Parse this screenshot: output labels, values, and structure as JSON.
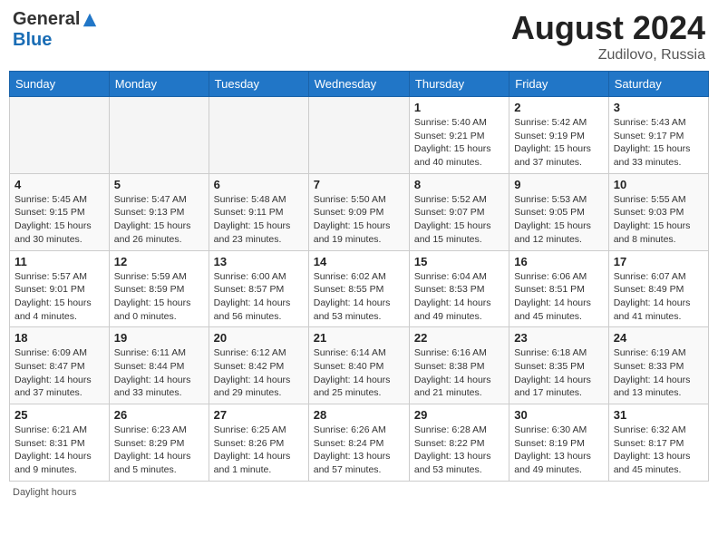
{
  "logo": {
    "general": "General",
    "blue": "Blue"
  },
  "title": {
    "month_year": "August 2024",
    "location": "Zudilovo, Russia"
  },
  "days_of_week": [
    "Sunday",
    "Monday",
    "Tuesday",
    "Wednesday",
    "Thursday",
    "Friday",
    "Saturday"
  ],
  "footer": {
    "daylight_label": "Daylight hours"
  },
  "weeks": [
    [
      {
        "day": "",
        "info": ""
      },
      {
        "day": "",
        "info": ""
      },
      {
        "day": "",
        "info": ""
      },
      {
        "day": "",
        "info": ""
      },
      {
        "day": "1",
        "info": "Sunrise: 5:40 AM\nSunset: 9:21 PM\nDaylight: 15 hours\nand 40 minutes."
      },
      {
        "day": "2",
        "info": "Sunrise: 5:42 AM\nSunset: 9:19 PM\nDaylight: 15 hours\nand 37 minutes."
      },
      {
        "day": "3",
        "info": "Sunrise: 5:43 AM\nSunset: 9:17 PM\nDaylight: 15 hours\nand 33 minutes."
      }
    ],
    [
      {
        "day": "4",
        "info": "Sunrise: 5:45 AM\nSunset: 9:15 PM\nDaylight: 15 hours\nand 30 minutes."
      },
      {
        "day": "5",
        "info": "Sunrise: 5:47 AM\nSunset: 9:13 PM\nDaylight: 15 hours\nand 26 minutes."
      },
      {
        "day": "6",
        "info": "Sunrise: 5:48 AM\nSunset: 9:11 PM\nDaylight: 15 hours\nand 23 minutes."
      },
      {
        "day": "7",
        "info": "Sunrise: 5:50 AM\nSunset: 9:09 PM\nDaylight: 15 hours\nand 19 minutes."
      },
      {
        "day": "8",
        "info": "Sunrise: 5:52 AM\nSunset: 9:07 PM\nDaylight: 15 hours\nand 15 minutes."
      },
      {
        "day": "9",
        "info": "Sunrise: 5:53 AM\nSunset: 9:05 PM\nDaylight: 15 hours\nand 12 minutes."
      },
      {
        "day": "10",
        "info": "Sunrise: 5:55 AM\nSunset: 9:03 PM\nDaylight: 15 hours\nand 8 minutes."
      }
    ],
    [
      {
        "day": "11",
        "info": "Sunrise: 5:57 AM\nSunset: 9:01 PM\nDaylight: 15 hours\nand 4 minutes."
      },
      {
        "day": "12",
        "info": "Sunrise: 5:59 AM\nSunset: 8:59 PM\nDaylight: 15 hours\nand 0 minutes."
      },
      {
        "day": "13",
        "info": "Sunrise: 6:00 AM\nSunset: 8:57 PM\nDaylight: 14 hours\nand 56 minutes."
      },
      {
        "day": "14",
        "info": "Sunrise: 6:02 AM\nSunset: 8:55 PM\nDaylight: 14 hours\nand 53 minutes."
      },
      {
        "day": "15",
        "info": "Sunrise: 6:04 AM\nSunset: 8:53 PM\nDaylight: 14 hours\nand 49 minutes."
      },
      {
        "day": "16",
        "info": "Sunrise: 6:06 AM\nSunset: 8:51 PM\nDaylight: 14 hours\nand 45 minutes."
      },
      {
        "day": "17",
        "info": "Sunrise: 6:07 AM\nSunset: 8:49 PM\nDaylight: 14 hours\nand 41 minutes."
      }
    ],
    [
      {
        "day": "18",
        "info": "Sunrise: 6:09 AM\nSunset: 8:47 PM\nDaylight: 14 hours\nand 37 minutes."
      },
      {
        "day": "19",
        "info": "Sunrise: 6:11 AM\nSunset: 8:44 PM\nDaylight: 14 hours\nand 33 minutes."
      },
      {
        "day": "20",
        "info": "Sunrise: 6:12 AM\nSunset: 8:42 PM\nDaylight: 14 hours\nand 29 minutes."
      },
      {
        "day": "21",
        "info": "Sunrise: 6:14 AM\nSunset: 8:40 PM\nDaylight: 14 hours\nand 25 minutes."
      },
      {
        "day": "22",
        "info": "Sunrise: 6:16 AM\nSunset: 8:38 PM\nDaylight: 14 hours\nand 21 minutes."
      },
      {
        "day": "23",
        "info": "Sunrise: 6:18 AM\nSunset: 8:35 PM\nDaylight: 14 hours\nand 17 minutes."
      },
      {
        "day": "24",
        "info": "Sunrise: 6:19 AM\nSunset: 8:33 PM\nDaylight: 14 hours\nand 13 minutes."
      }
    ],
    [
      {
        "day": "25",
        "info": "Sunrise: 6:21 AM\nSunset: 8:31 PM\nDaylight: 14 hours\nand 9 minutes."
      },
      {
        "day": "26",
        "info": "Sunrise: 6:23 AM\nSunset: 8:29 PM\nDaylight: 14 hours\nand 5 minutes."
      },
      {
        "day": "27",
        "info": "Sunrise: 6:25 AM\nSunset: 8:26 PM\nDaylight: 14 hours\nand 1 minute."
      },
      {
        "day": "28",
        "info": "Sunrise: 6:26 AM\nSunset: 8:24 PM\nDaylight: 13 hours\nand 57 minutes."
      },
      {
        "day": "29",
        "info": "Sunrise: 6:28 AM\nSunset: 8:22 PM\nDaylight: 13 hours\nand 53 minutes."
      },
      {
        "day": "30",
        "info": "Sunrise: 6:30 AM\nSunset: 8:19 PM\nDaylight: 13 hours\nand 49 minutes."
      },
      {
        "day": "31",
        "info": "Sunrise: 6:32 AM\nSunset: 8:17 PM\nDaylight: 13 hours\nand 45 minutes."
      }
    ]
  ]
}
